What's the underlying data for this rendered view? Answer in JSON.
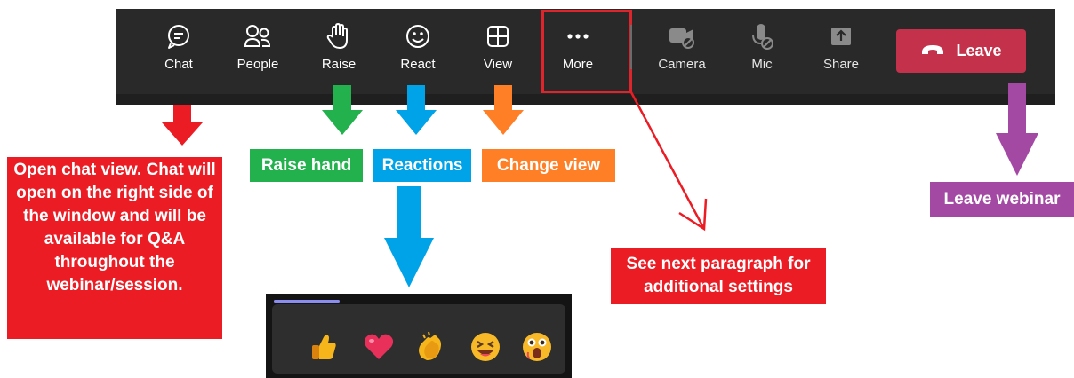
{
  "toolbar": {
    "chat_label": "Chat",
    "people_label": "People",
    "raise_label": "Raise",
    "react_label": "React",
    "view_label": "View",
    "more_label": "More",
    "camera_label": "Camera",
    "mic_label": "Mic",
    "share_label": "Share",
    "leave_label": "Leave"
  },
  "annotations": {
    "chat": "Open chat view. Chat will open on the right side of the window and will be available for Q&A throughout the webinar/session.",
    "raise": "Raise hand",
    "reactions": "Reactions",
    "view": "Change view",
    "more": "See next paragraph for additional settings",
    "leave": "Leave webinar"
  },
  "colors": {
    "toolbar_bg": "#292929",
    "leave_red": "#c4314b",
    "chat_red": "#ec1c24",
    "raise_green": "#22b14c",
    "reactions_blue": "#00a2e8",
    "view_orange": "#ff7f27",
    "leave_purple": "#a349a4"
  },
  "reactions": {
    "items": [
      "thumbs-up",
      "heart",
      "clapping-hands",
      "laughing-face",
      "surprised-face"
    ]
  }
}
